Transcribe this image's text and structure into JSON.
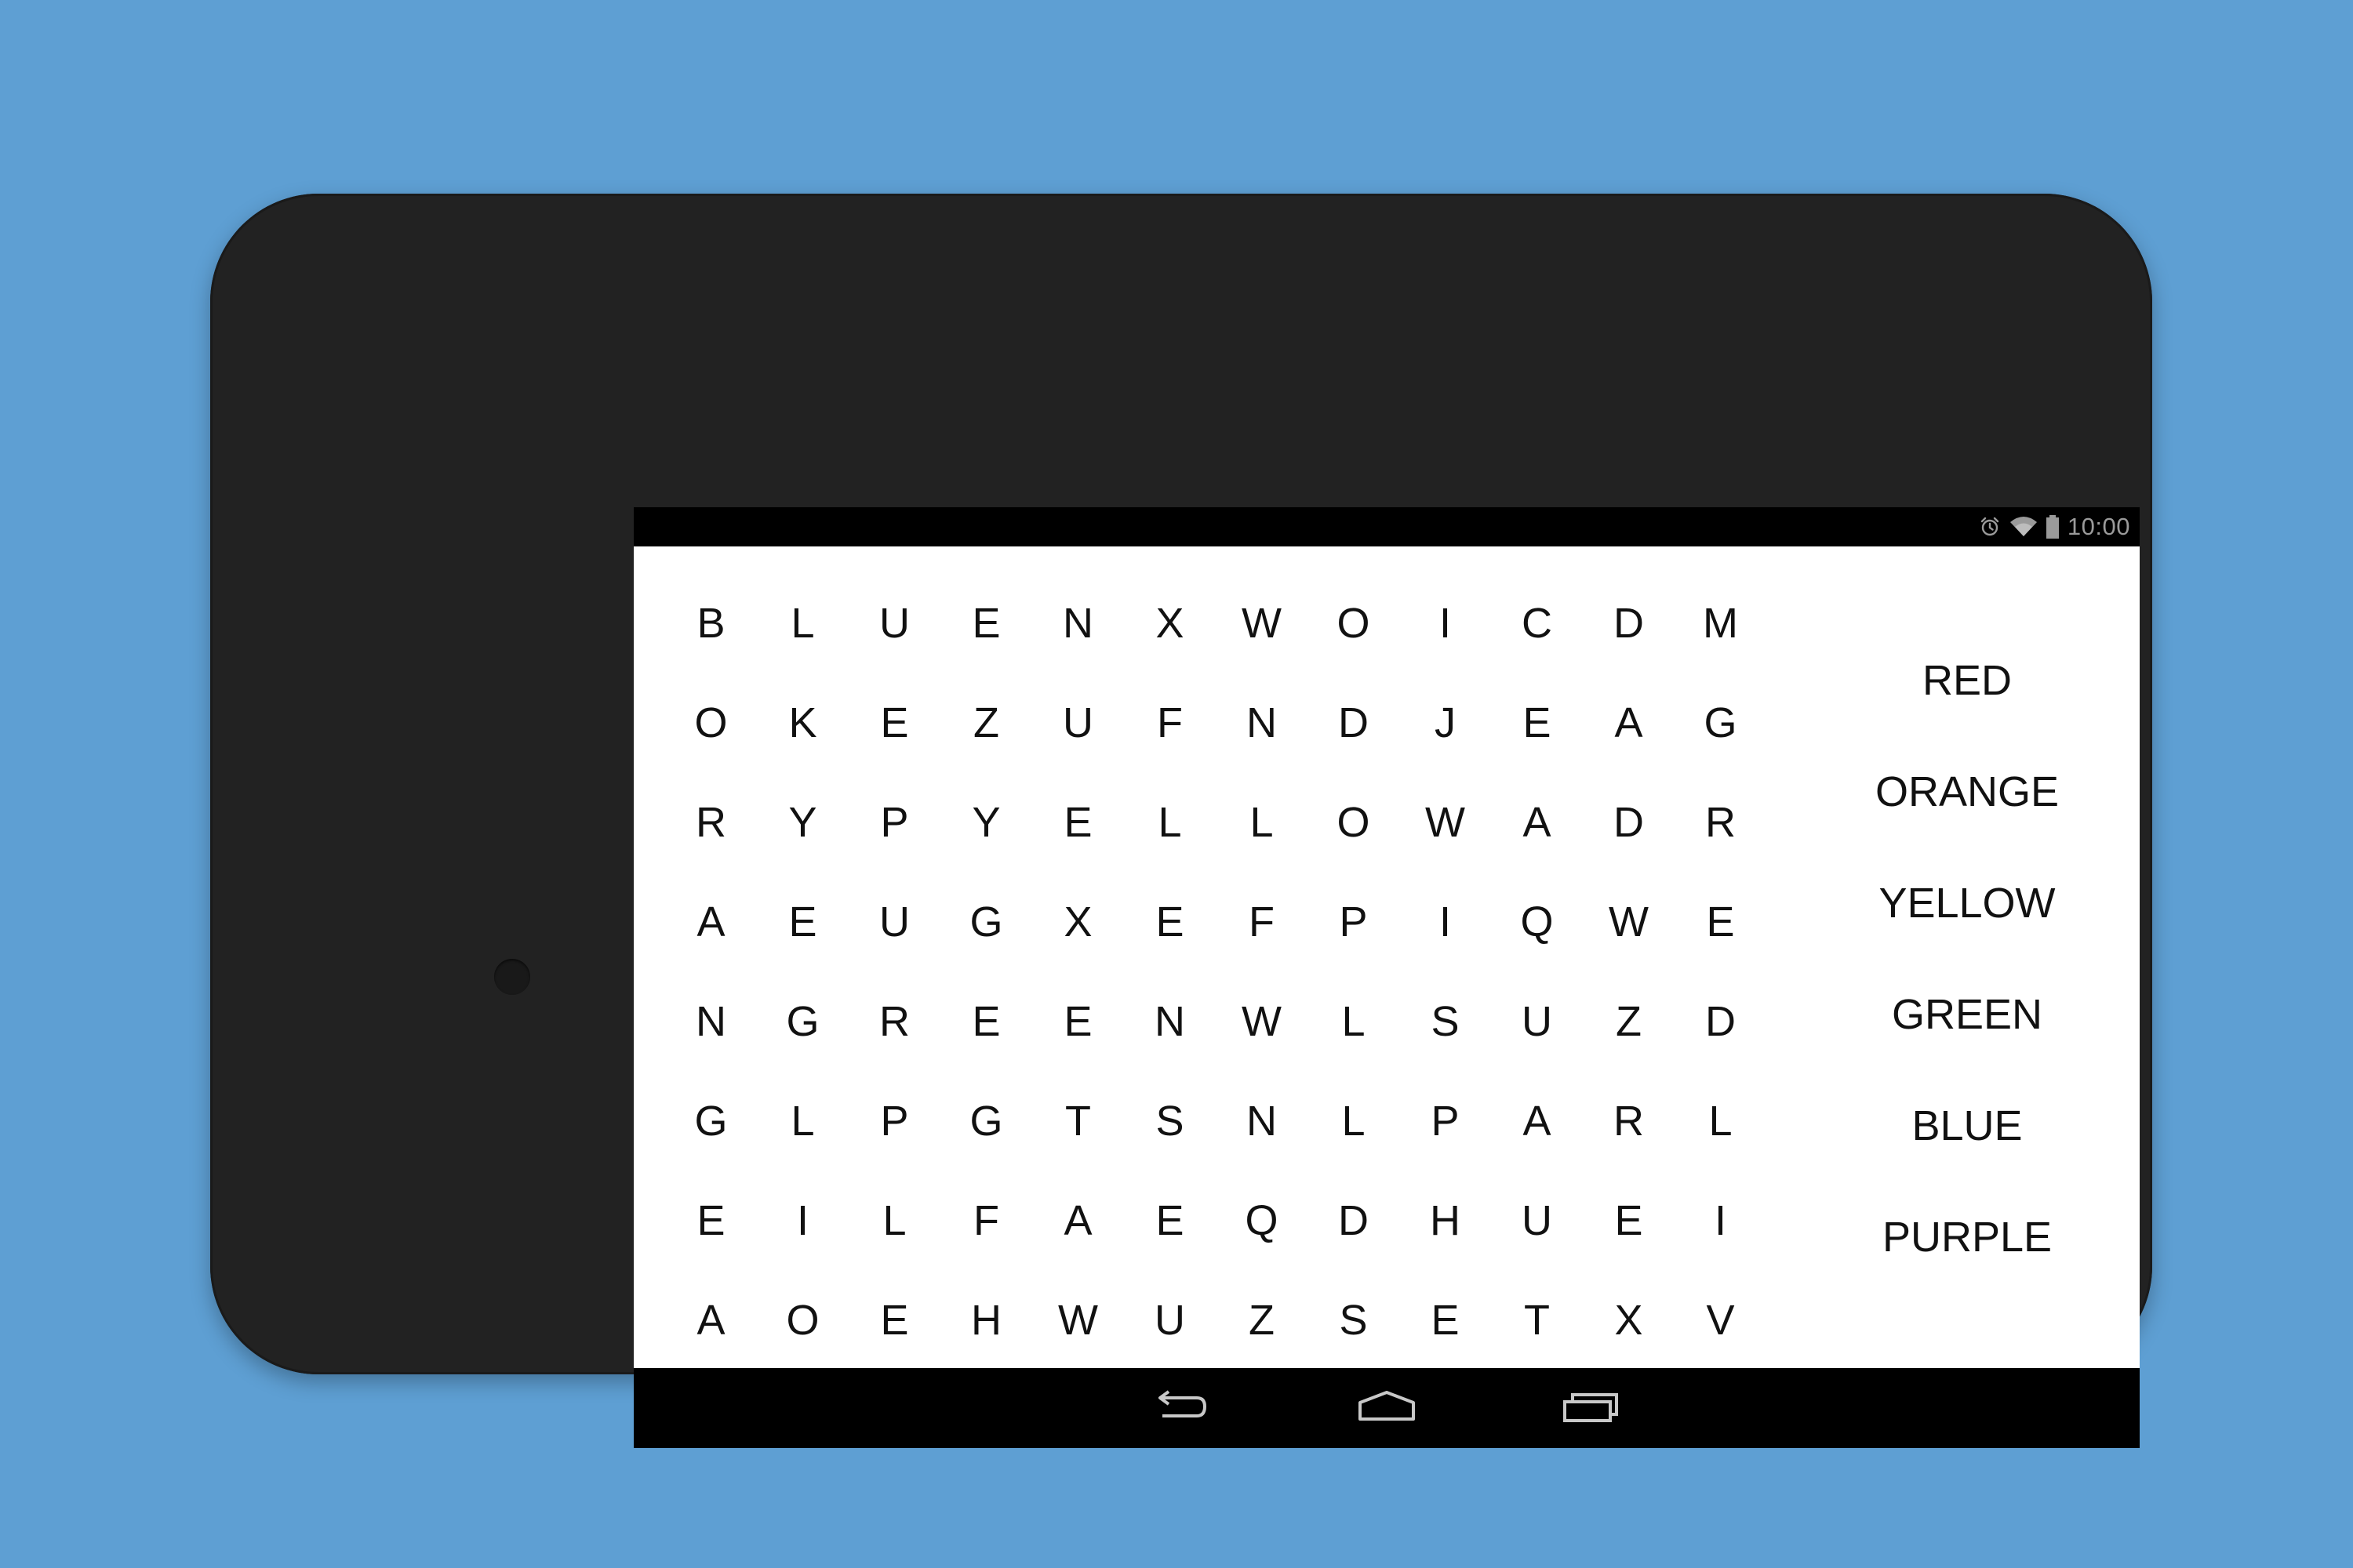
{
  "status_bar": {
    "time": "10:00",
    "icons": [
      "alarm-icon",
      "wifi-icon",
      "battery-icon"
    ]
  },
  "puzzle": {
    "grid": [
      [
        "B",
        "L",
        "U",
        "E",
        "N",
        "X",
        "W",
        "O",
        "I",
        "C",
        "D",
        "M"
      ],
      [
        "O",
        "K",
        "E",
        "Z",
        "U",
        "F",
        "N",
        "D",
        "J",
        "E",
        "A",
        "G"
      ],
      [
        "R",
        "Y",
        "P",
        "Y",
        "E",
        "L",
        "L",
        "O",
        "W",
        "A",
        "D",
        "R"
      ],
      [
        "A",
        "E",
        "U",
        "G",
        "X",
        "E",
        "F",
        "P",
        "I",
        "Q",
        "W",
        "E"
      ],
      [
        "N",
        "G",
        "R",
        "E",
        "E",
        "N",
        "W",
        "L",
        "S",
        "U",
        "Z",
        "D"
      ],
      [
        "G",
        "L",
        "P",
        "G",
        "T",
        "S",
        "N",
        "L",
        "P",
        "A",
        "R",
        "L"
      ],
      [
        "E",
        "I",
        "L",
        "F",
        "A",
        "E",
        "Q",
        "D",
        "H",
        "U",
        "E",
        "I"
      ],
      [
        "A",
        "O",
        "E",
        "H",
        "W",
        "U",
        "Z",
        "S",
        "E",
        "T",
        "X",
        "V"
      ]
    ],
    "words": [
      "RED",
      "ORANGE",
      "YELLOW",
      "GREEN",
      "BLUE",
      "PURPLE"
    ]
  },
  "nav_bar": {
    "buttons": [
      "back-icon",
      "home-icon",
      "recents-icon"
    ]
  },
  "colors": {
    "background": "#5e9fd3",
    "device_body": "#222222",
    "app_background": "#ffffff",
    "letter_color": "#111111",
    "system_icons": "#9a9a9a"
  }
}
